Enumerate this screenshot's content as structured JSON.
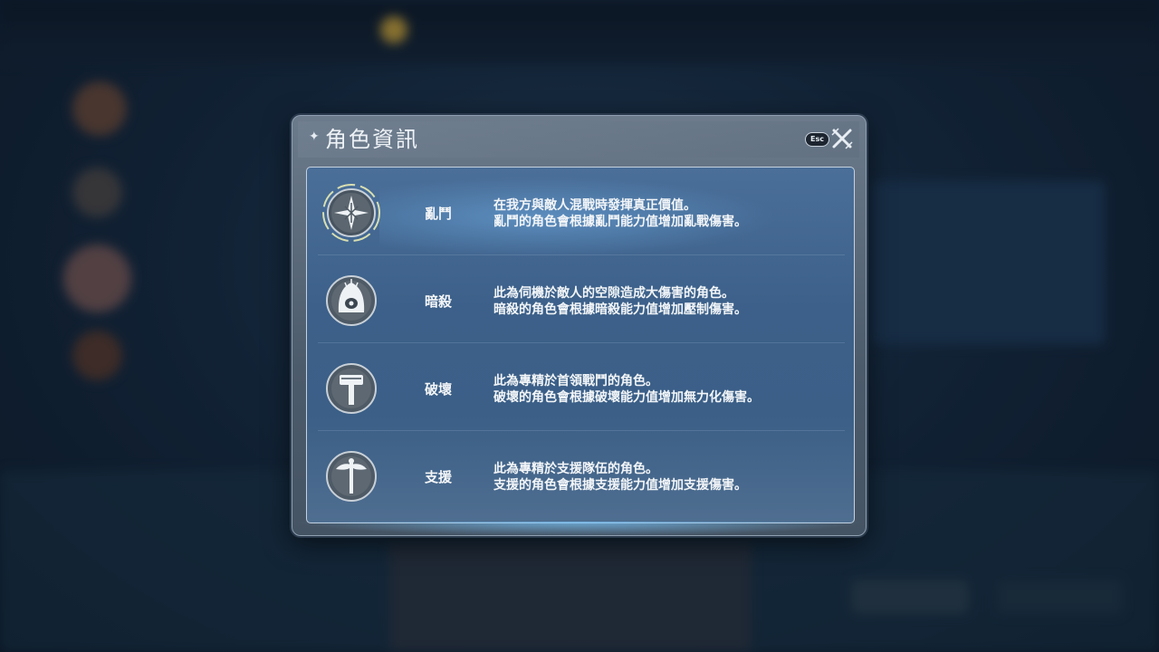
{
  "dialog": {
    "title": "角色資訊",
    "esc_label": "Esc"
  },
  "roles": [
    {
      "name": "亂鬥",
      "icon": "melee-role-icon",
      "desc1": "在我方與敵人混戰時發揮真正價值。",
      "desc2": "亂鬥的角色會根據亂鬥能力值增加亂戰傷害。"
    },
    {
      "name": "暗殺",
      "icon": "assassin-role-icon",
      "desc1": "此為伺機於敵人的空隙造成大傷害的角色。",
      "desc2": "暗殺的角色會根據暗殺能力值增加壓制傷害。"
    },
    {
      "name": "破壞",
      "icon": "destroyer-role-icon",
      "desc1": "此為專精於首領戰鬥的角色。",
      "desc2": "破壞的角色會根據破壞能力值增加無力化傷害。"
    },
    {
      "name": "支援",
      "icon": "support-role-icon",
      "desc1": "此為專精於支援隊伍的角色。",
      "desc2": "支援的角色會根據支援能力值增加支援傷害。"
    }
  ]
}
